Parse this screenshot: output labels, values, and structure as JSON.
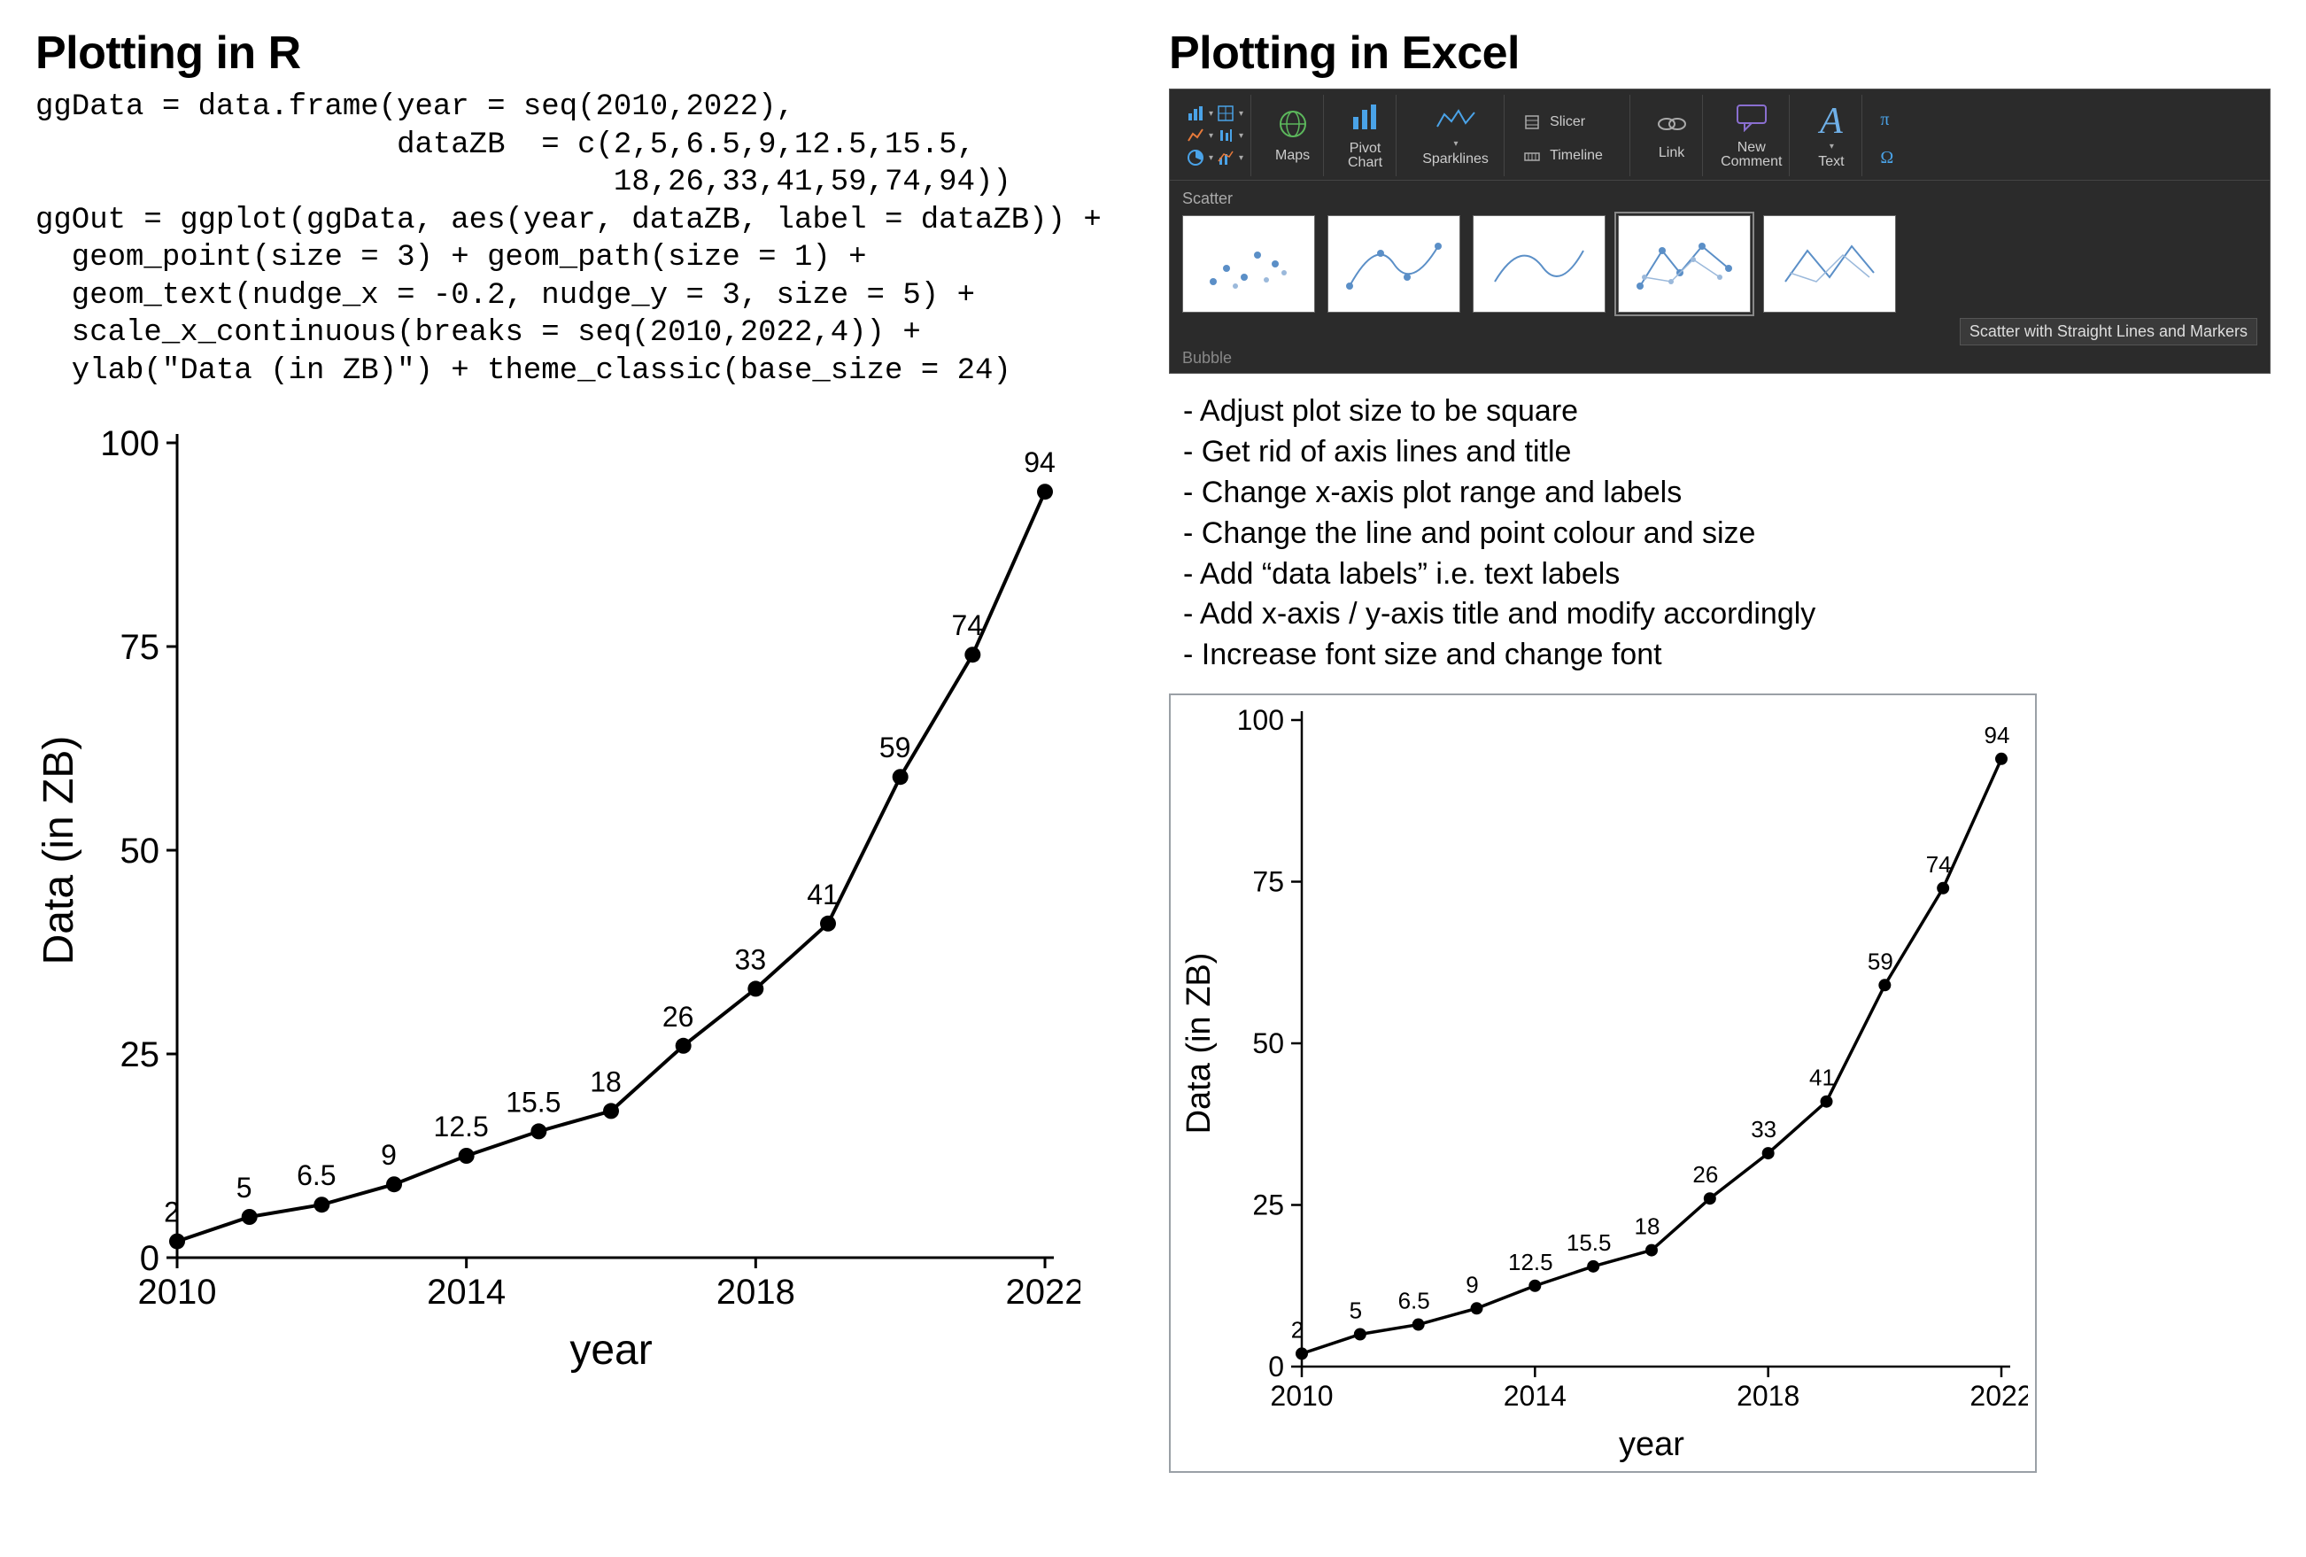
{
  "left": {
    "title": "Plotting in R",
    "code": "ggData = data.frame(year = seq(2010,2022),\n                    dataZB  = c(2,5,6.5,9,12.5,15.5,\n                                18,26,33,41,59,74,94))\nggOut = ggplot(ggData, aes(year, dataZB, label = dataZB)) +\n  geom_point(size = 3) + geom_path(size = 1) +\n  geom_text(nudge_x = -0.2, nudge_y = 3, size = 5) +\n  scale_x_continuous(breaks = seq(2010,2022,4)) +\n  ylab(\"Data (in ZB)\") + theme_classic(base_size = 24)"
  },
  "right": {
    "title": "Plotting in Excel",
    "ribbon": {
      "gallery_title": "Scatter",
      "gallery_footer": "Bubble",
      "tooltip": "Scatter with Straight Lines and Markers",
      "labels": {
        "maps": "Maps",
        "pivot": "Pivot\nChart",
        "sparklines": "Sparklines",
        "slicer": "Slicer",
        "timeline": "Timeline",
        "link": "Link",
        "newcomment": "New\nComment",
        "text": "Text"
      }
    },
    "steps": [
      "Adjust plot size to be square",
      "Get rid of axis lines and title",
      "Change x-axis plot range and labels",
      "Change the line and point colour and size",
      "Add “data labels” i.e. text labels",
      "Add x-axis / y-axis title and modify accordingly",
      "Increase font size and change font"
    ]
  },
  "chart_data": {
    "type": "line",
    "title": "",
    "xlabel": "year",
    "ylabel": "Data (in ZB)",
    "x": [
      2010,
      2011,
      2012,
      2013,
      2014,
      2015,
      2016,
      2017,
      2018,
      2019,
      2020,
      2021,
      2022
    ],
    "values": [
      2,
      5,
      6.5,
      9,
      12.5,
      15.5,
      18,
      26,
      33,
      41,
      59,
      74,
      94
    ],
    "data_labels": [
      "2",
      "5",
      "6.5",
      "9",
      "12.5",
      "15.5",
      "18",
      "26",
      "33",
      "41",
      "59",
      "74",
      "94"
    ],
    "x_ticks": [
      2010,
      2014,
      2018,
      2022
    ],
    "y_ticks": [
      0,
      25,
      50,
      75,
      100
    ],
    "xlim": [
      2010,
      2022
    ],
    "ylim": [
      0,
      100
    ]
  }
}
